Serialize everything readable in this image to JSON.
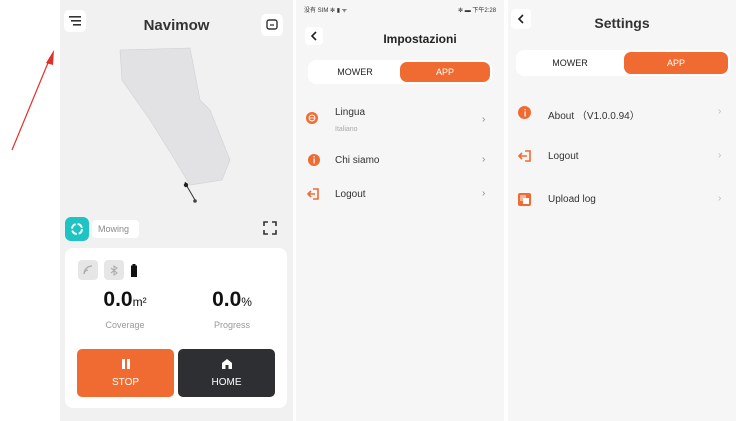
{
  "mower_screen": {
    "title": "Navimow",
    "menu_icon": "menu-icon",
    "message_icon": "message-icon",
    "mode_label": "Mowing",
    "coverage_value": "0.0",
    "coverage_unit": "m²",
    "coverage_label": "Coverage",
    "progress_value": "0.0",
    "progress_unit": "%",
    "progress_label": "Progress",
    "stop_label": "STOP",
    "home_label": "HOME"
  },
  "settings_it": {
    "status_left": "没有 SIM ✻ ▮ ᯤ",
    "status_right": "✻ ▬ 下午2:28",
    "title": "Impostazioni",
    "tab_mower": "MOWER",
    "tab_app": "APP",
    "items": [
      {
        "label": "Lingua",
        "sub": "Italiano"
      },
      {
        "label": "Chi siamo"
      },
      {
        "label": "Logout"
      }
    ]
  },
  "settings_en": {
    "title": "Settings",
    "tab_mower": "MOWER",
    "tab_app": "APP",
    "items": [
      {
        "label": "About （V1.0.0.94）"
      },
      {
        "label": "Logout"
      },
      {
        "label": "Upload log"
      }
    ]
  },
  "colors": {
    "accent": "#f06b32",
    "dark_button": "#2e2f33",
    "teal": "#1fc3c4"
  }
}
